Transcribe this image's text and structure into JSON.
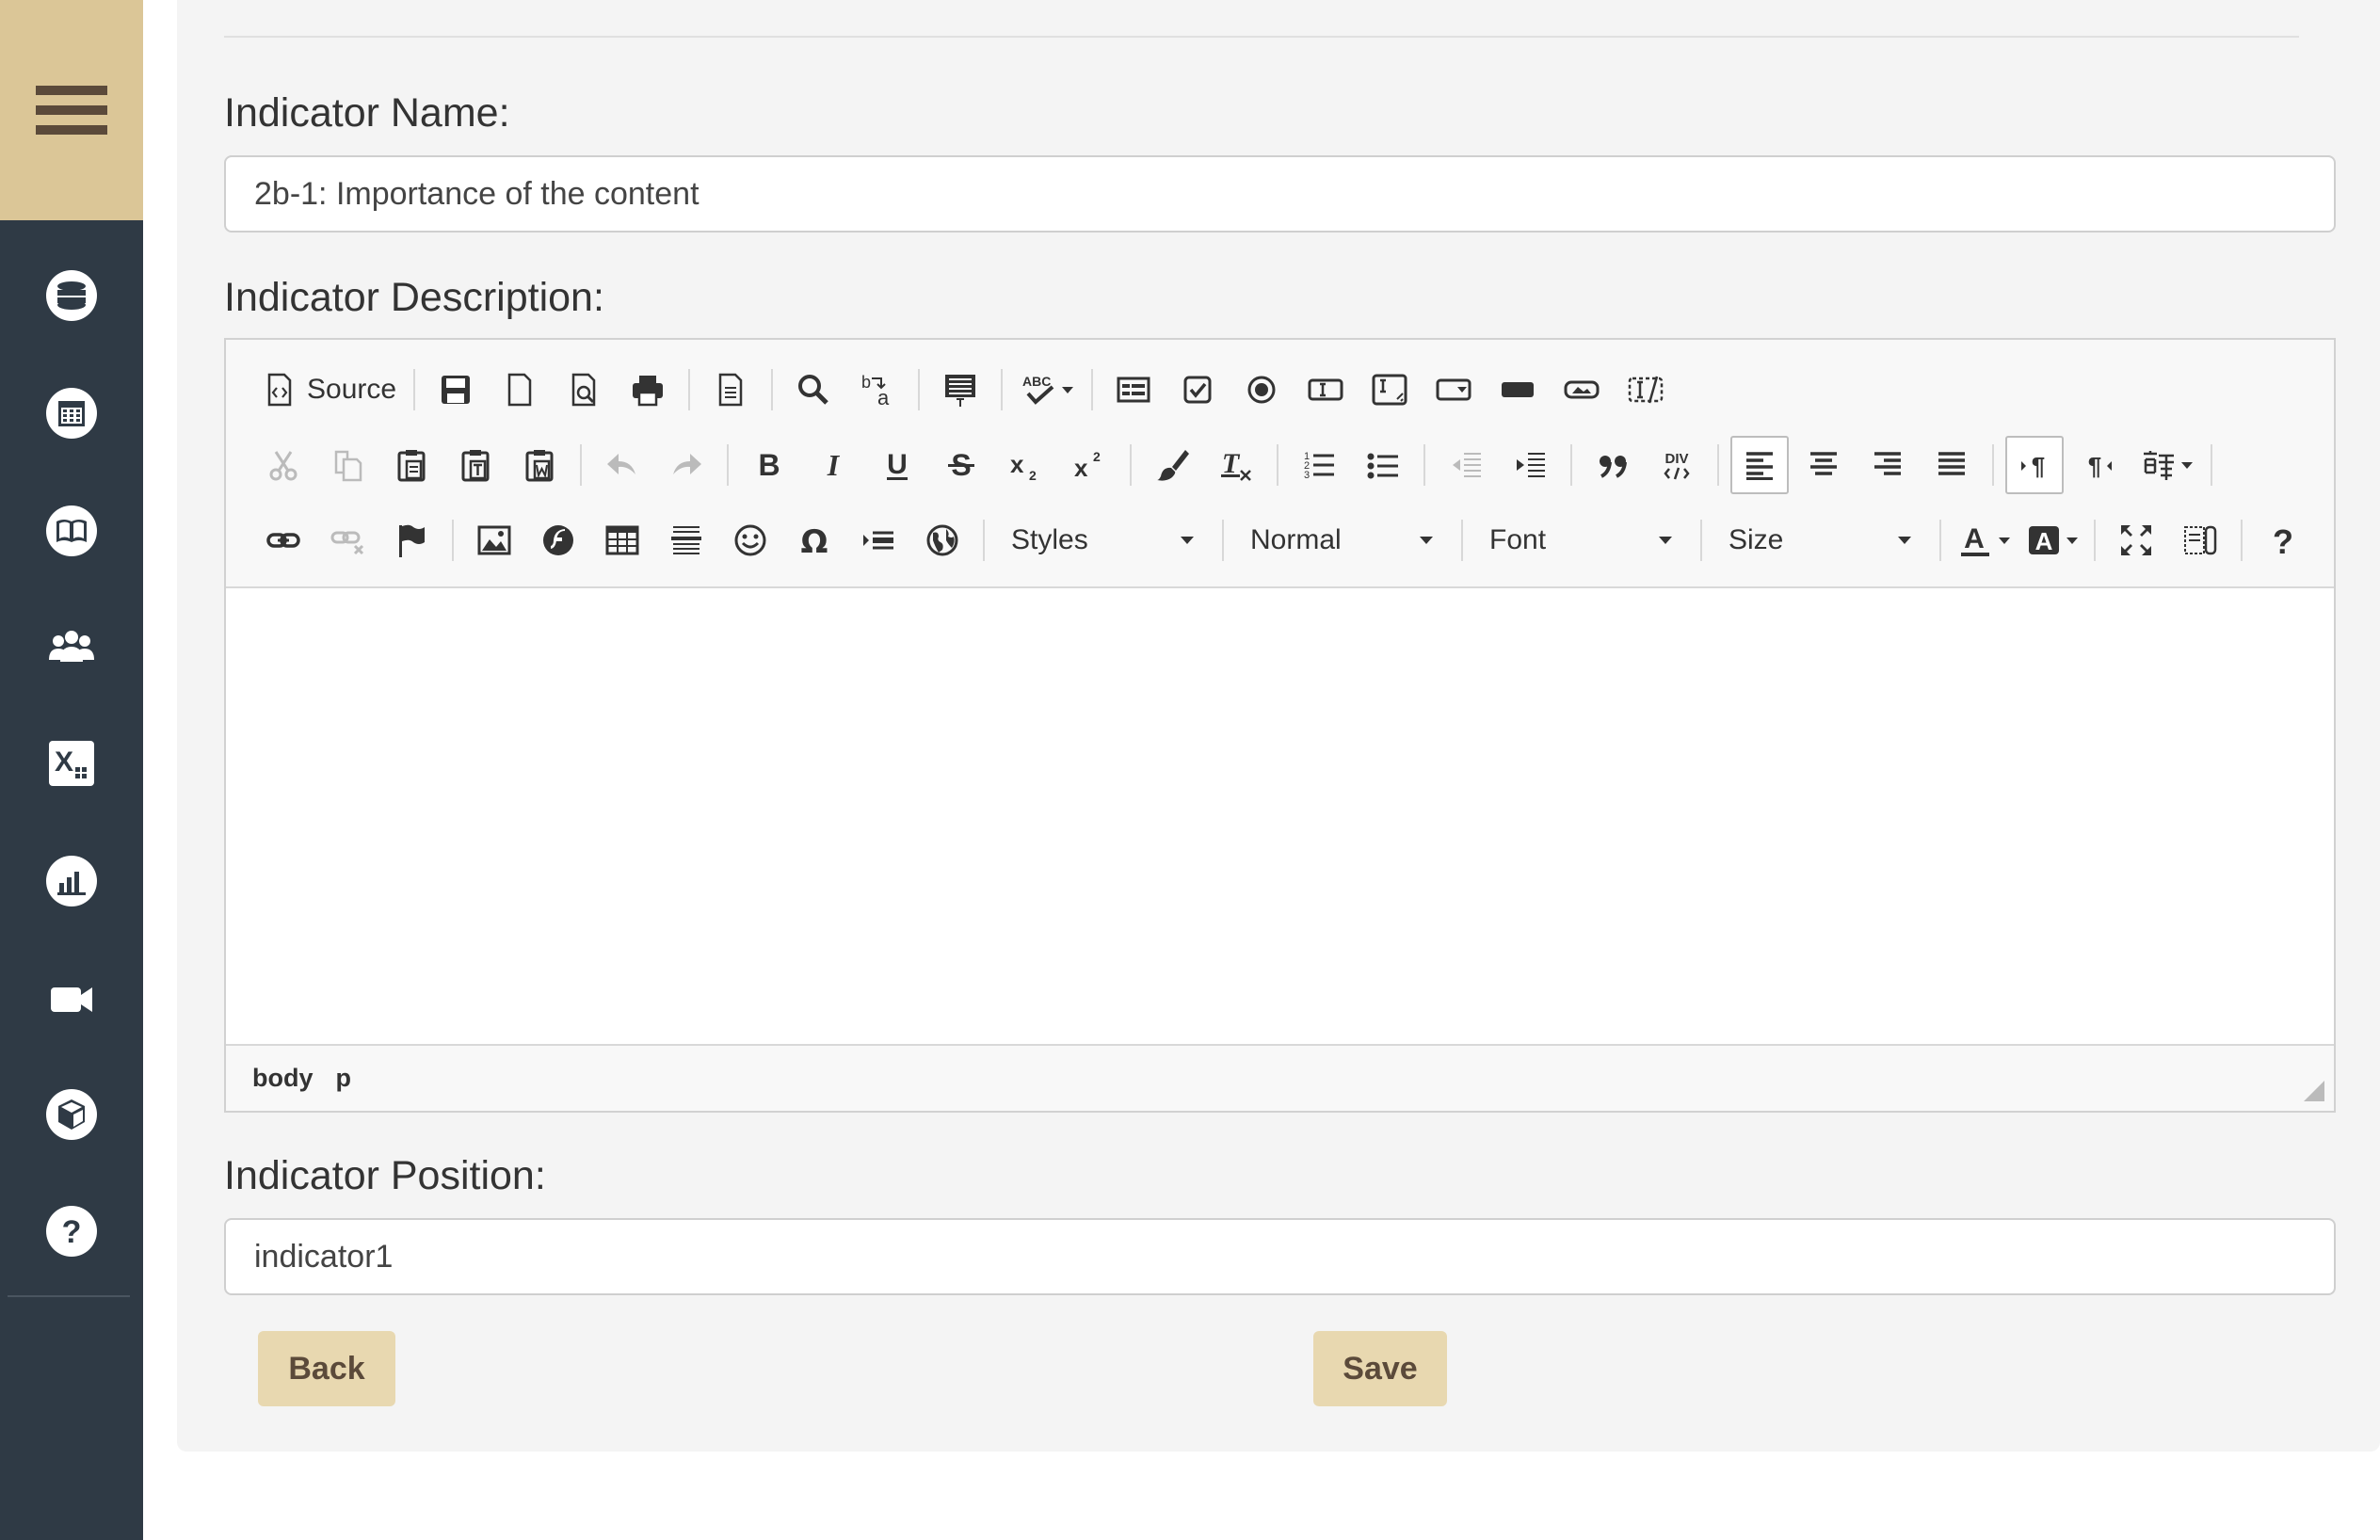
{
  "sidebar": {
    "toggle_icon": "hamburger-menu-icon",
    "items": [
      {
        "name": "database-icon"
      },
      {
        "name": "calendar-icon"
      },
      {
        "name": "book-icon"
      },
      {
        "name": "users-group-icon"
      },
      {
        "name": "excel-icon"
      },
      {
        "name": "bar-chart-icon"
      },
      {
        "name": "video-camera-icon"
      },
      {
        "name": "cube-icon"
      },
      {
        "name": "help-icon"
      }
    ],
    "colors": {
      "background": "#2f3a45",
      "toggle": "#dbc697"
    }
  },
  "form": {
    "name_label": "Indicator Name:",
    "name_value": "2b-1: Importance of the content",
    "description_label": "Indicator Description:",
    "position_label": "Indicator Position:",
    "position_value": "indicator1"
  },
  "editor": {
    "source_label": "Source",
    "styles_label": "Styles",
    "format_label": "Normal",
    "font_label": "Font",
    "size_label": "Size",
    "divcontainer_label": "DIV",
    "help_label": "?",
    "text_color_label": "A",
    "bg_color_label": "A",
    "statusbar": {
      "path": [
        "body",
        "p"
      ]
    }
  },
  "buttons": {
    "back_label": "Back",
    "save_label": "Save"
  }
}
